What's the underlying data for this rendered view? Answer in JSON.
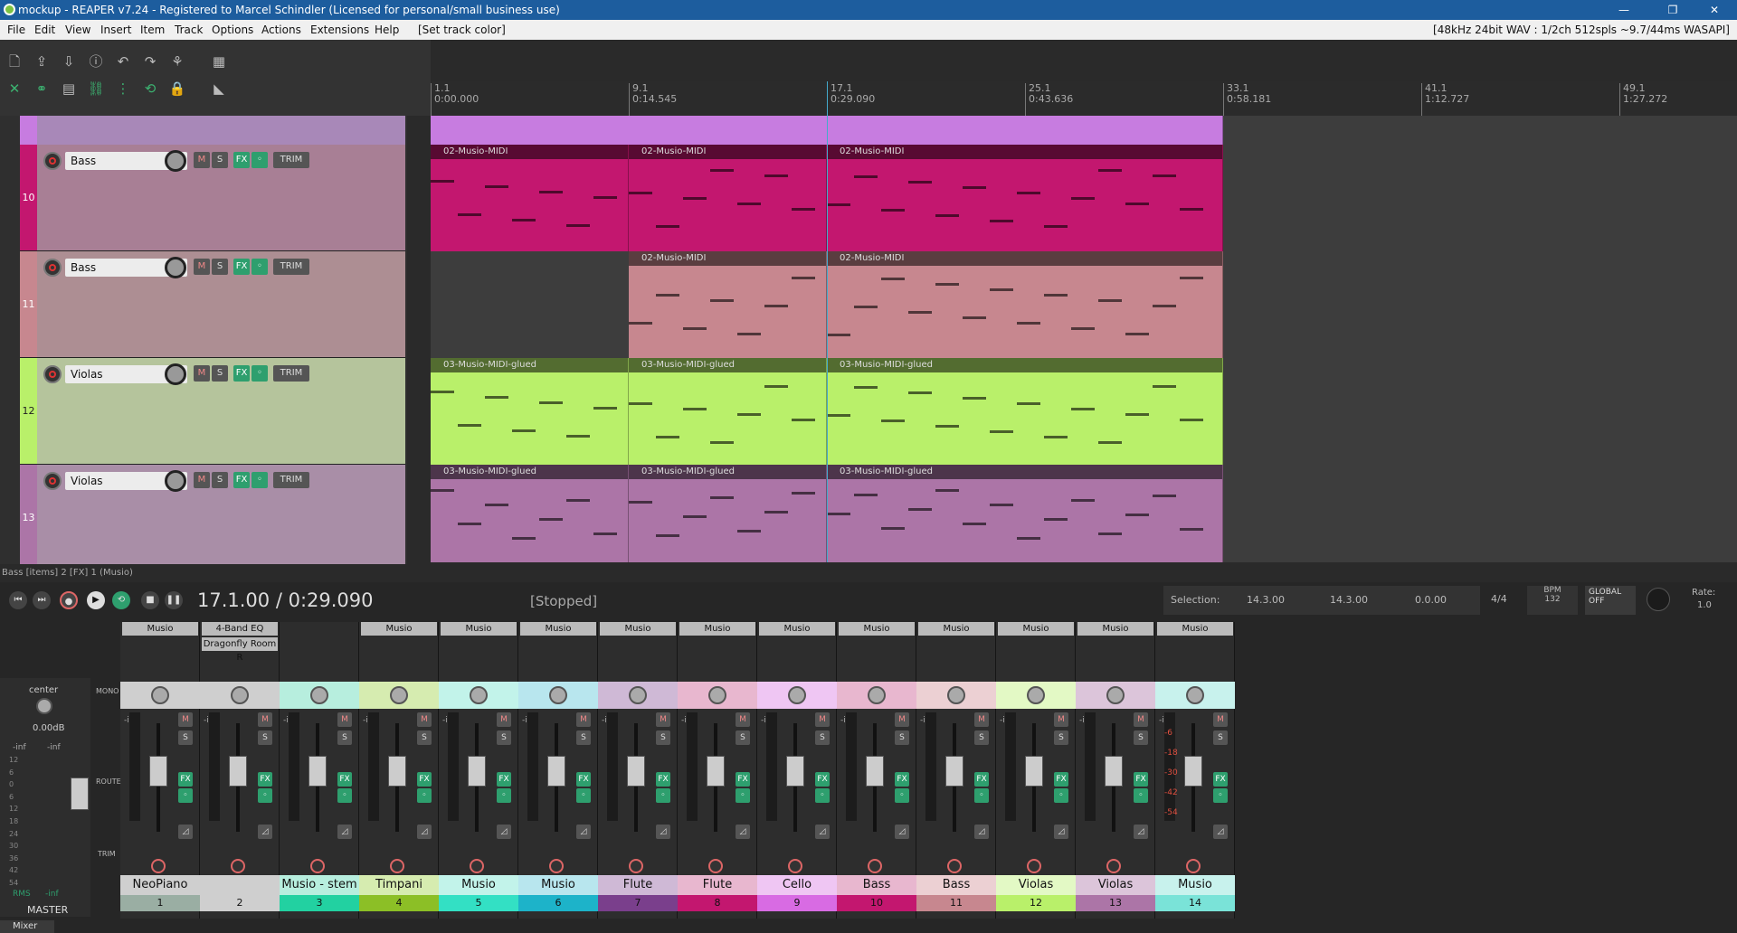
{
  "title": "mockup - REAPER v7.24 - Registered to Marcel Schindler (Licensed for personal/small business use)",
  "window_controls": [
    "—",
    "❐",
    "✕"
  ],
  "menu": [
    "File",
    "Edit",
    "View",
    "Insert",
    "Item",
    "Track",
    "Options",
    "Actions",
    "Extensions",
    "Help",
    "[Set track color]"
  ],
  "audio_status": "[48kHz 24bit WAV : 1/2ch 512spls ~9.7/44ms WASAPI]",
  "ruler": [
    {
      "bar": "1.1",
      "time": "0:00.000"
    },
    {
      "bar": "9.1",
      "time": "0:14.545"
    },
    {
      "bar": "17.1",
      "time": "0:29.090"
    },
    {
      "bar": "25.1",
      "time": "0:43.636"
    },
    {
      "bar": "33.1",
      "time": "0:58.181"
    },
    {
      "bar": "41.1",
      "time": "1:12.727"
    },
    {
      "bar": "49.1",
      "time": "1:27.272"
    }
  ],
  "tracks": [
    {
      "name": "",
      "num": "",
      "color": "#c77ce0"
    },
    {
      "name": "Bass",
      "num": "10",
      "color": "#c3176f",
      "lane": "#b2879c"
    },
    {
      "name": "Bass",
      "num": "11",
      "color": "#c7878f",
      "lane": "#b2969a"
    },
    {
      "name": "Violas",
      "num": "12",
      "color": "#b9f06a",
      "lane": "#b9c7a0"
    },
    {
      "name": "Violas",
      "num": "13",
      "color": "#ac75a7",
      "lane": "#b097aa"
    }
  ],
  "track_buttons": {
    "m": "M",
    "s": "S",
    "fx": "FX",
    "io": "◦",
    "trim": "TRIM"
  },
  "items": {
    "row10": [
      "02-Musio-MIDI",
      "02-Musio-MIDI",
      "02-Musio-MIDI"
    ],
    "row11": [
      "02-Musio-MIDI",
      "02-Musio-MIDI"
    ],
    "row12": [
      "03-Musio-MIDI-glued",
      "03-Musio-MIDI-glued",
      "03-Musio-MIDI-glued"
    ],
    "row13": [
      "03-Musio-MIDI-glued",
      "03-Musio-MIDI-glued",
      "03-Musio-MIDI-glued"
    ]
  },
  "status_line": "Bass [items] 2 [FX] 1 (Musio)",
  "transport": {
    "position": "17.1.00 / 0:29.090",
    "state": "[Stopped]",
    "selection_label": "Selection:",
    "sel_start": "14.3.00",
    "sel_end": "14.3.00",
    "sel_len": "0.0.00",
    "timesig": "4/4",
    "bpm_label": "BPM",
    "bpm": "132",
    "global": "GLOBAL",
    "global_state": "OFF",
    "rate_label": "Rate:",
    "rate": "1.0"
  },
  "master": {
    "pan": "center",
    "vol": "0.00dB",
    "inf_l": "-inf",
    "inf_r": "-inf",
    "rms": "RMS",
    "rms_val": "-inf",
    "label": "MASTER",
    "mono": "MONO",
    "route": "ROUTE",
    "trim": "TRIM",
    "scale": [
      "12",
      "6",
      "0",
      "6",
      "12",
      "18",
      "24",
      "30",
      "36",
      "42",
      "54"
    ]
  },
  "mixer_tab": "Mixer",
  "channels": [
    {
      "fx": "Musio",
      "fx2": "",
      "name": "NeoPiano",
      "num": "1",
      "color": "#9aaea3",
      "lbl": "#cfcfcf"
    },
    {
      "fx": "4-Band EQ",
      "fx2": "Dragonfly Room R",
      "name": "",
      "num": "2",
      "color": "#cfcfcf",
      "lbl": "#cfcfcf"
    },
    {
      "fx": "",
      "fx2": "",
      "name": "Musio - stem",
      "num": "3",
      "color": "#22d1a1",
      "lbl": "#b7eede"
    },
    {
      "fx": "Musio",
      "fx2": "",
      "name": "Timpani",
      "num": "4",
      "color": "#8cbf26",
      "lbl": "#d6ecb0"
    },
    {
      "fx": "Musio",
      "fx2": "",
      "name": "Musio",
      "num": "5",
      "color": "#33e0c4",
      "lbl": "#c2f3ea"
    },
    {
      "fx": "Musio",
      "fx2": "",
      "name": "Musio",
      "num": "6",
      "color": "#1db3c9",
      "lbl": "#b8e6ee"
    },
    {
      "fx": "Musio",
      "fx2": "",
      "name": "Flute",
      "num": "7",
      "color": "#7a3f8c",
      "lbl": "#cfb9d6"
    },
    {
      "fx": "Musio",
      "fx2": "",
      "name": "Flute",
      "num": "8",
      "color": "#c3176f",
      "lbl": "#e8b7cf"
    },
    {
      "fx": "Musio",
      "fx2": "",
      "name": "Cello",
      "num": "9",
      "color": "#d86be3",
      "lbl": "#efc6f3"
    },
    {
      "fx": "Musio",
      "fx2": "",
      "name": "Bass",
      "num": "10",
      "color": "#c3176f",
      "lbl": "#e8b7cf"
    },
    {
      "fx": "Musio",
      "fx2": "",
      "name": "Bass",
      "num": "11",
      "color": "#c7878f",
      "lbl": "#ecd0d3"
    },
    {
      "fx": "Musio",
      "fx2": "",
      "name": "Violas",
      "num": "12",
      "color": "#b9f06a",
      "lbl": "#e3f9c5"
    },
    {
      "fx": "Musio",
      "fx2": "",
      "name": "Violas",
      "num": "13",
      "color": "#ac75a7",
      "lbl": "#dcc5da"
    },
    {
      "fx": "Musio",
      "fx2": "",
      "name": "Musio",
      "num": "14",
      "color": "#7ae3d8",
      "lbl": "#c8f2ed"
    }
  ],
  "mixer_inf": "-inf",
  "meter_scale_14": [
    "-6",
    "-18",
    "-30",
    "-42",
    "-54"
  ]
}
